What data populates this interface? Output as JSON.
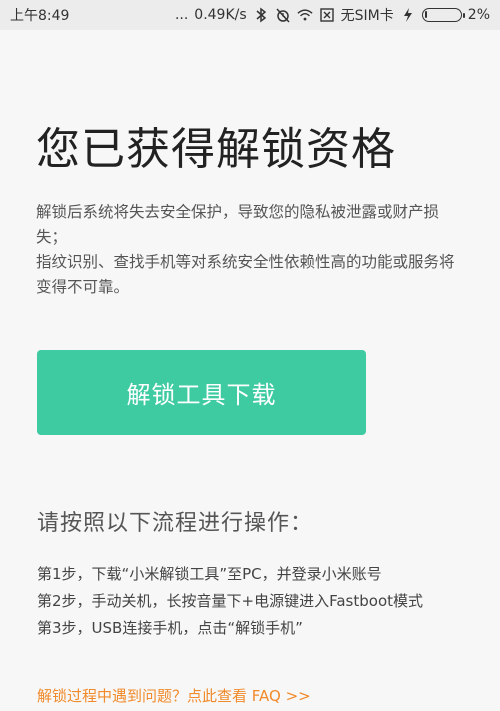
{
  "status_bar": {
    "time": "上午8:49",
    "dots": "...",
    "speed": "0.49K/s",
    "sim": "无SIM卡",
    "battery_percent": "2%",
    "battery_level": 0.05,
    "icons": [
      "bluetooth-icon",
      "alarm-off-icon",
      "wifi-icon",
      "sim-x-icon",
      "charging-icon",
      "battery-icon"
    ]
  },
  "main": {
    "title": "您已获得解锁资格",
    "warning_lines": [
      "解锁后系统将失去安全保护，导致您的隐私被泄露或财产损失；",
      "指纹识别、查找手机等对系统安全性依赖性高的功能或服务将变得不可靠。"
    ],
    "download_button": "解锁工具下载",
    "steps_title": "请按照以下流程进行操作：",
    "steps": [
      "第1步，下载“小米解锁工具”至PC，并登录小米账号",
      "第2步，手动关机，长按音量下+电源键进入Fastboot模式",
      "第3步，USB连接手机，点击“解锁手机”"
    ],
    "faq_link": "解锁过程中遇到问题？点此查看 FAQ >>"
  },
  "colors": {
    "accent": "#3ecba1",
    "link": "#f08a2a",
    "background": "#f7f7f7"
  }
}
